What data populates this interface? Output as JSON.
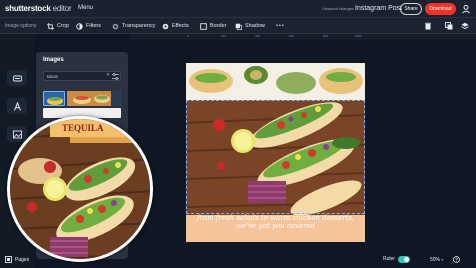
{
  "header": {
    "logo": "shutterstock",
    "logo_suffix": "editor",
    "menu_label": "Menu",
    "unsaved_text": "Unsaved changes",
    "document_title": "Instagram Post",
    "share_label": "Share",
    "download_label": "Download"
  },
  "toolbar": {
    "section_label": "Image options",
    "crop": "Crop",
    "filters": "Filters",
    "transparency": "Transparency",
    "effects": "Effects",
    "border": "Border",
    "shadow": "Shadow",
    "more": "•••"
  },
  "ruler_ticks": [
    "0",
    "200",
    "400",
    "600",
    "800",
    "1000"
  ],
  "panel": {
    "title": "Images",
    "search_value": "tacos"
  },
  "magnifier": {
    "banner_text": "TEQUILA"
  },
  "canvas": {
    "caption": "from fresh salads to warm chicken desserts, we've got you covered"
  },
  "footer": {
    "pages_label": "Pages",
    "ruler_label": "Ruler",
    "ruler_on": true,
    "zoom": "50%"
  },
  "colors": {
    "accent": "#f0322b",
    "toggle": "#2ec4b6",
    "caption_band": "#f6c49b"
  }
}
